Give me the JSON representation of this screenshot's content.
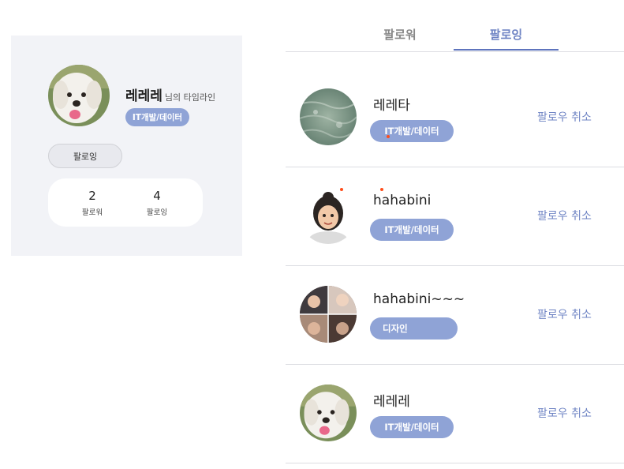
{
  "profile": {
    "name": "레레레",
    "suffix": "님의 타임라인",
    "category": "IT개발/데이터",
    "follow_button": "팔로잉",
    "stats": [
      {
        "count": "2",
        "label": "팔로워"
      },
      {
        "count": "4",
        "label": "팔로잉"
      }
    ]
  },
  "tabs": [
    {
      "label": "팔로워",
      "active": false
    },
    {
      "label": "팔로잉",
      "active": true
    }
  ],
  "following": [
    {
      "name": "레레타",
      "category": "IT개발/데이터",
      "action": "팔로우 취소",
      "avatar": "water-photo"
    },
    {
      "name": "hahabini",
      "category": "IT개발/데이터",
      "action": "팔로우 취소",
      "avatar": "memoji-girl"
    },
    {
      "name": "hahabini~~~",
      "category": "디자인",
      "action": "팔로우 취소",
      "avatar": "photo-collage"
    },
    {
      "name": "레레레",
      "category": "IT개발/데이터",
      "action": "팔로우 취소",
      "avatar": "puppy-photo"
    }
  ],
  "colors": {
    "accent": "#6f84c4",
    "pill": "#8fa3d6",
    "card_bg": "#f2f3f7",
    "divider": "#dcdde2"
  }
}
